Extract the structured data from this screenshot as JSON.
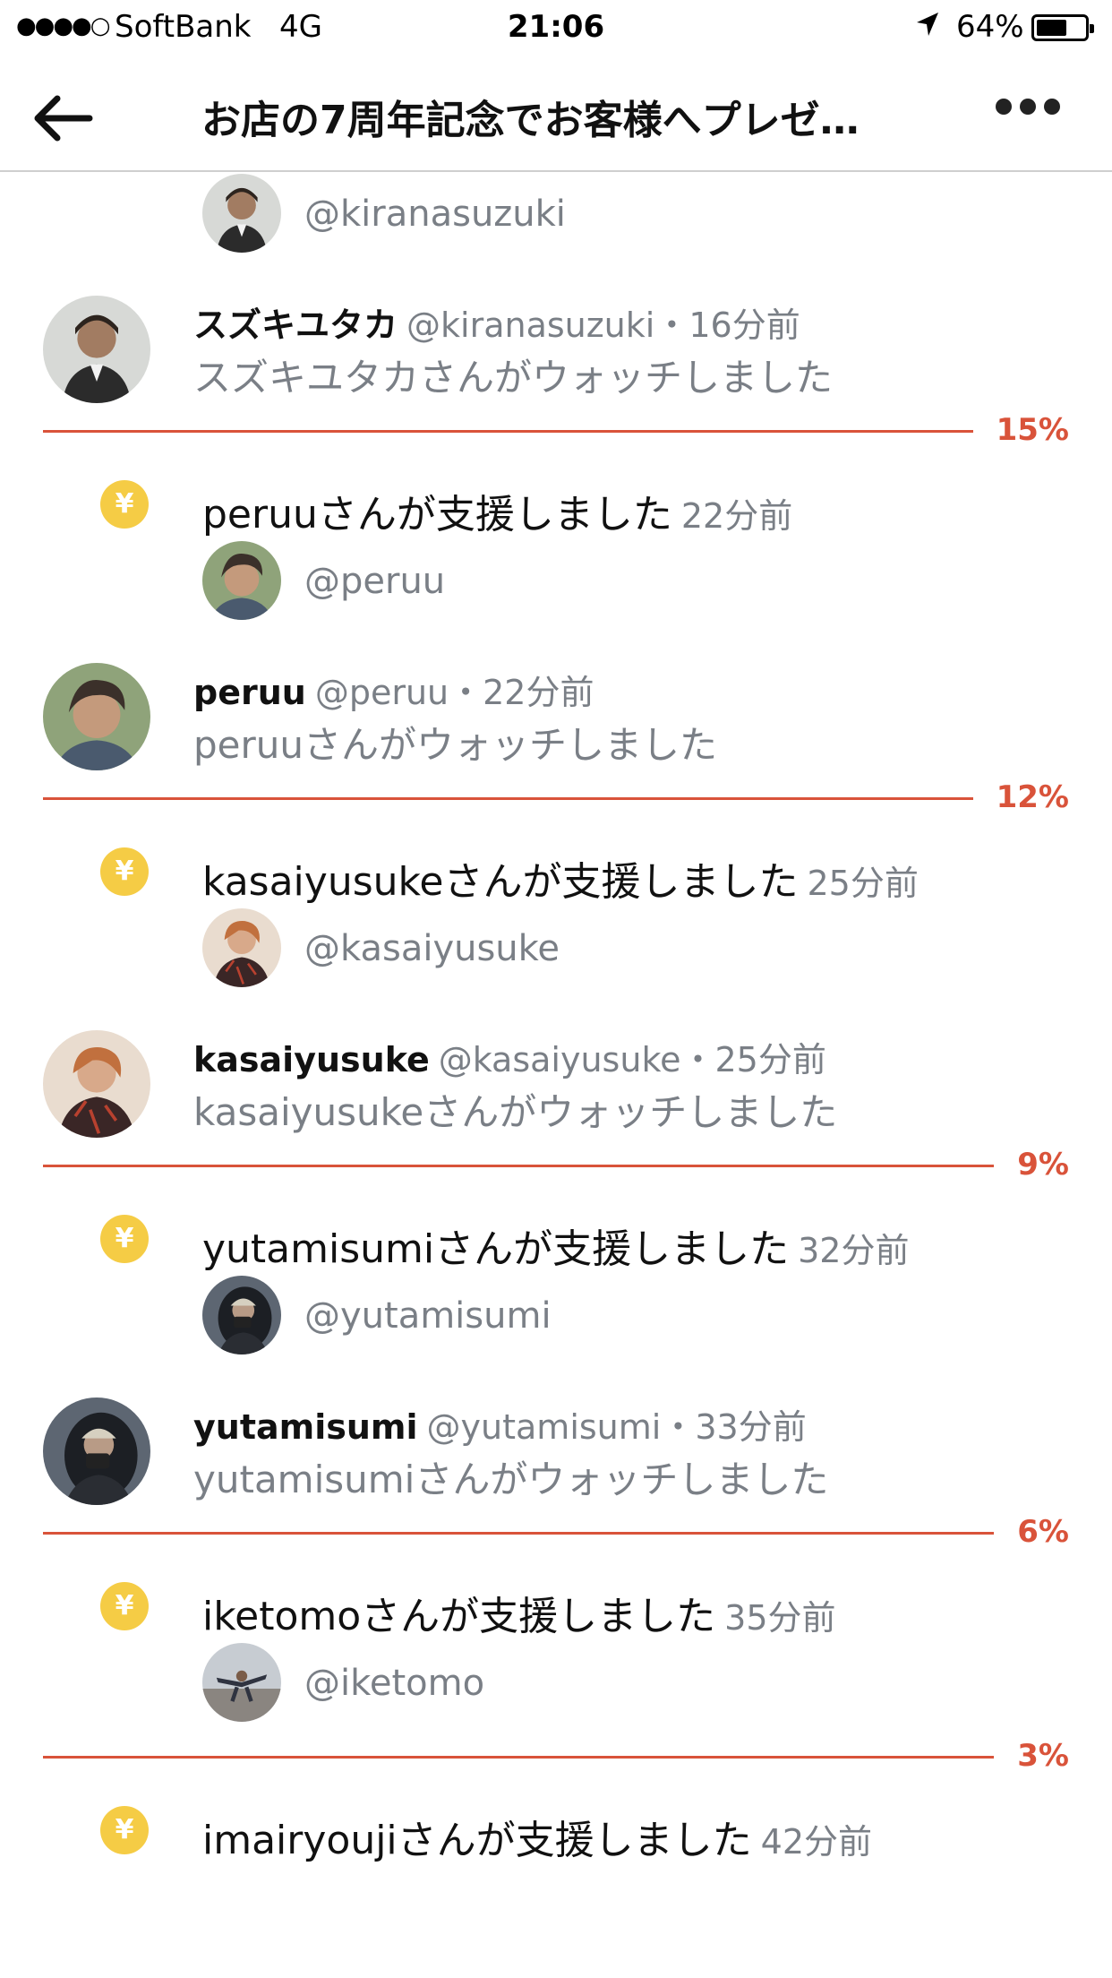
{
  "status_bar": {
    "signal_dots": "●●●●○",
    "carrier": "SoftBank",
    "network": "4G",
    "time": "21:06",
    "battery_percent": "64%",
    "battery_level": 0.64
  },
  "nav": {
    "title": "お店の7周年記念でお客様へプレゼ…"
  },
  "feed": {
    "top_mention": {
      "handle": "@kiranasuzuki"
    },
    "groups": [
      {
        "watch": {
          "name": "スズキユタカ",
          "meta": "@kiranasuzuki・16分前",
          "message": "スズキユタカさんがウォッチしました"
        },
        "percent": "15%",
        "percent_value": 15,
        "support": {
          "text": "peruuさんが支援しました",
          "time": "22分前",
          "handle": "@peruu"
        }
      },
      {
        "watch": {
          "name": "peruu",
          "meta": "@peruu・22分前",
          "message": "peruuさんがウォッチしました"
        },
        "percent": "12%",
        "percent_value": 12,
        "support": {
          "text": "kasaiyusukeさんが支援しました",
          "time": "25分前",
          "handle": "@kasaiyusuke"
        }
      },
      {
        "watch": {
          "name": "kasaiyusuke",
          "meta": "@kasaiyusuke・25分前",
          "message": "kasaiyusukeさんがウォッチしました"
        },
        "percent": "9%",
        "percent_value": 9,
        "support": {
          "text": "yutamisumiさんが支援しました",
          "time": "32分前",
          "handle": "@yutamisumi"
        }
      },
      {
        "watch": {
          "name": "yutamisumi",
          "meta": "@yutamisumi・33分前",
          "message": "yutamisumiさんがウォッチしました"
        },
        "percent": "6%",
        "percent_value": 6,
        "support": {
          "text": "iketomoさんが支援しました",
          "time": "35分前",
          "handle": "@iketomo"
        }
      },
      {
        "percent": "3%",
        "percent_value": 3,
        "support": {
          "text": "imairyoujiさんが支援しました",
          "time": "42分前"
        }
      }
    ],
    "yen_symbol": "¥",
    "accent_color": "#d9533a",
    "yen_color": "#f5cc45"
  }
}
